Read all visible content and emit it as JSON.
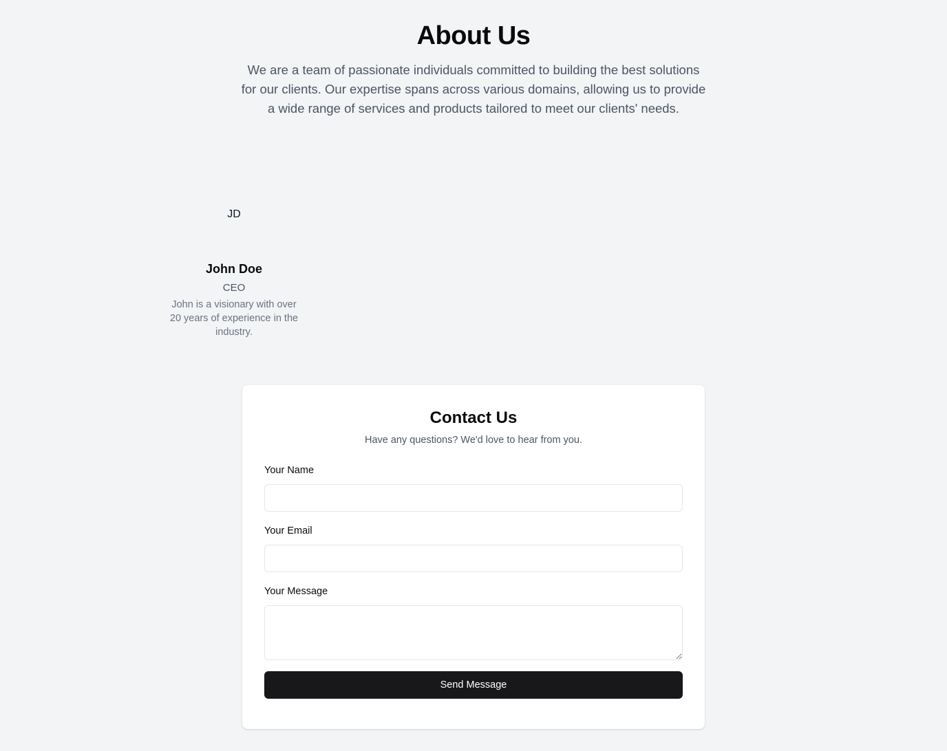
{
  "about": {
    "title": "About Us",
    "description": "We are a team of passionate individuals committed to building the best solutions for our clients. Our expertise spans across various domains, allowing us to provide a wide range of services and products tailored to meet our clients' needs."
  },
  "team": [
    {
      "initials": "JD",
      "name": "John Doe",
      "role": "CEO",
      "bio": "John is a visionary with over 20 years of experience in the industry."
    }
  ],
  "contact": {
    "title": "Contact Us",
    "subtitle": "Have any questions? We'd love to hear from you.",
    "name_label": "Your Name",
    "name_value": "",
    "email_label": "Your Email",
    "email_value": "",
    "message_label": "Your Message",
    "message_value": "",
    "send_label": "Send Message"
  },
  "colors": {
    "background": "#f3f4f6",
    "card": "#ffffff",
    "button": "#18181b",
    "muted_text": "#4b5563"
  }
}
